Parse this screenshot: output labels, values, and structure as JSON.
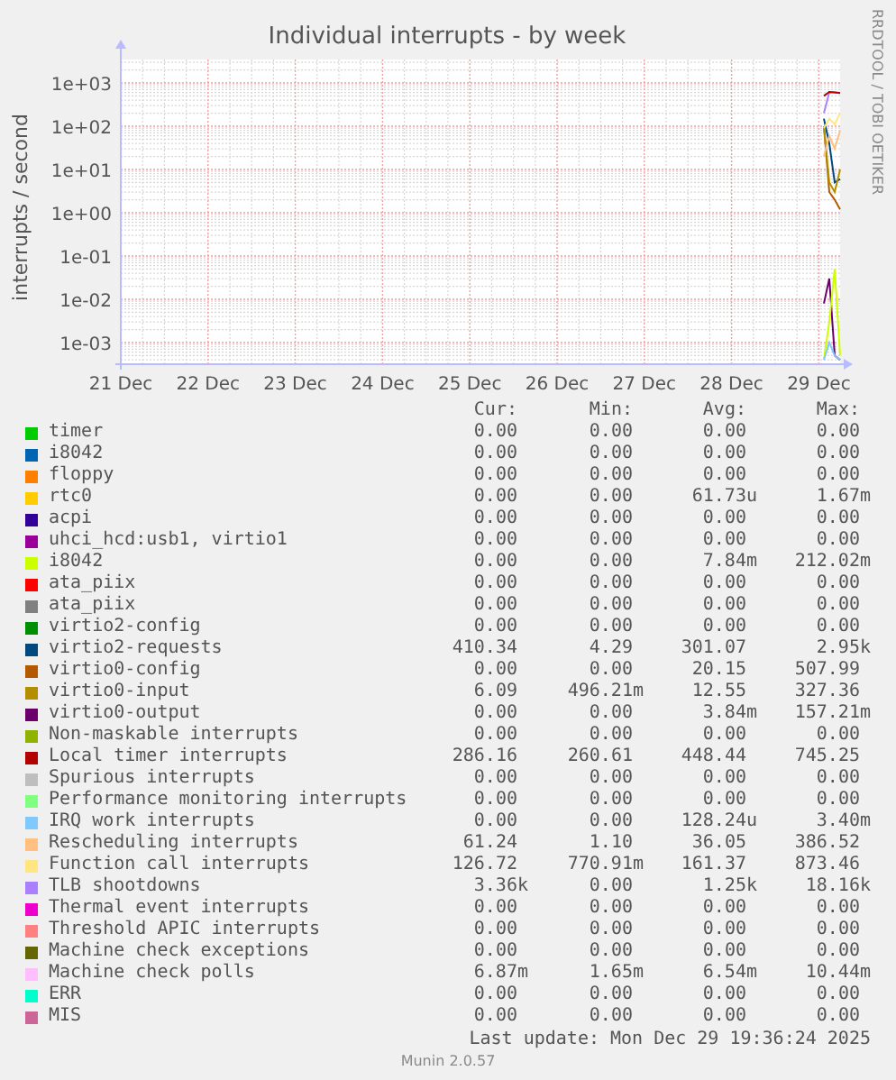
{
  "graph": {
    "title": "Individual interrupts - by week",
    "credit": "RRDTOOL / TOBI OETIKER",
    "y_axis_title": "interrupts / second",
    "y_axis_labels": [
      "1e+03",
      "1e+02",
      "1e+01",
      "1e+00",
      "1e-01",
      "1e-02",
      "1e-03"
    ],
    "x_axis_labels": [
      "21 Dec",
      "22 Dec",
      "23 Dec",
      "24 Dec",
      "25 Dec",
      "26 Dec",
      "27 Dec",
      "28 Dec",
      "29 Dec"
    ]
  },
  "legend": {
    "columns": [
      "Cur:",
      "Min:",
      "Avg:",
      "Max:"
    ],
    "rows": [
      {
        "name": "timer",
        "color": "#00cc00",
        "cur": "0.00",
        "min": "0.00",
        "avg": "0.00",
        "max": "0.00"
      },
      {
        "name": "i8042",
        "color": "#0066b3",
        "cur": "0.00",
        "min": "0.00",
        "avg": "0.00",
        "max": "0.00"
      },
      {
        "name": "floppy",
        "color": "#ff8000",
        "cur": "0.00",
        "min": "0.00",
        "avg": "0.00",
        "max": "0.00"
      },
      {
        "name": "rtc0",
        "color": "#ffcc00",
        "cur": "0.00",
        "min": "0.00",
        "avg": "61.73u",
        "max": "1.67m"
      },
      {
        "name": "acpi",
        "color": "#330099",
        "cur": "0.00",
        "min": "0.00",
        "avg": "0.00",
        "max": "0.00"
      },
      {
        "name": "uhci_hcd:usb1, virtio1",
        "color": "#990099",
        "cur": "0.00",
        "min": "0.00",
        "avg": "0.00",
        "max": "0.00"
      },
      {
        "name": "i8042",
        "color": "#ccff00",
        "cur": "0.00",
        "min": "0.00",
        "avg": "7.84m",
        "max": "212.02m"
      },
      {
        "name": "ata_piix",
        "color": "#ff0000",
        "cur": "0.00",
        "min": "0.00",
        "avg": "0.00",
        "max": "0.00"
      },
      {
        "name": "ata_piix",
        "color": "#808080",
        "cur": "0.00",
        "min": "0.00",
        "avg": "0.00",
        "max": "0.00"
      },
      {
        "name": "virtio2-config",
        "color": "#008f00",
        "cur": "0.00",
        "min": "0.00",
        "avg": "0.00",
        "max": "0.00"
      },
      {
        "name": "virtio2-requests",
        "color": "#00487d",
        "cur": "410.34",
        "min": "4.29",
        "avg": "301.07",
        "max": "2.95k"
      },
      {
        "name": "virtio0-config",
        "color": "#b35a00",
        "cur": "0.00",
        "min": "0.00",
        "avg": "20.15",
        "max": "507.99"
      },
      {
        "name": "virtio0-input",
        "color": "#b38f00",
        "cur": "6.09",
        "min": "496.21m",
        "avg": "12.55",
        "max": "327.36"
      },
      {
        "name": "virtio0-output",
        "color": "#6b006b",
        "cur": "0.00",
        "min": "0.00",
        "avg": "3.84m",
        "max": "157.21m"
      },
      {
        "name": "Non-maskable interrupts",
        "color": "#8fb300",
        "cur": "0.00",
        "min": "0.00",
        "avg": "0.00",
        "max": "0.00"
      },
      {
        "name": "Local timer interrupts",
        "color": "#b30000",
        "cur": "286.16",
        "min": "260.61",
        "avg": "448.44",
        "max": "745.25"
      },
      {
        "name": "Spurious interrupts",
        "color": "#bebebe",
        "cur": "0.00",
        "min": "0.00",
        "avg": "0.00",
        "max": "0.00"
      },
      {
        "name": "Performance monitoring interrupts",
        "color": "#80ff80",
        "cur": "0.00",
        "min": "0.00",
        "avg": "0.00",
        "max": "0.00"
      },
      {
        "name": "IRQ work interrupts",
        "color": "#80c9ff",
        "cur": "0.00",
        "min": "0.00",
        "avg": "128.24u",
        "max": "3.40m"
      },
      {
        "name": "Rescheduling interrupts",
        "color": "#ffc080",
        "cur": "61.24",
        "min": "1.10",
        "avg": "36.05",
        "max": "386.52"
      },
      {
        "name": "Function call interrupts",
        "color": "#ffe680",
        "cur": "126.72",
        "min": "770.91m",
        "avg": "161.37",
        "max": "873.46"
      },
      {
        "name": "TLB shootdowns",
        "color": "#aa80ff",
        "cur": "3.36k",
        "min": "0.00",
        "avg": "1.25k",
        "max": "18.16k"
      },
      {
        "name": "Thermal event interrupts",
        "color": "#ee00cc",
        "cur": "0.00",
        "min": "0.00",
        "avg": "0.00",
        "max": "0.00"
      },
      {
        "name": "Threshold APIC interrupts",
        "color": "#ff8080",
        "cur": "0.00",
        "min": "0.00",
        "avg": "0.00",
        "max": "0.00"
      },
      {
        "name": "Machine check exceptions",
        "color": "#666600",
        "cur": "0.00",
        "min": "0.00",
        "avg": "0.00",
        "max": "0.00"
      },
      {
        "name": "Machine check polls",
        "color": "#ffbfff",
        "cur": "6.87m",
        "min": "1.65m",
        "avg": "6.54m",
        "max": "10.44m"
      },
      {
        "name": "ERR",
        "color": "#00ffcc",
        "cur": "0.00",
        "min": "0.00",
        "avg": "0.00",
        "max": "0.00"
      },
      {
        "name": "MIS",
        "color": "#cc6699",
        "cur": "0.00",
        "min": "0.00",
        "avg": "0.00",
        "max": "0.00"
      }
    ]
  },
  "last_update": "Last update: Mon Dec 29 19:36:24 2025",
  "version": "Munin 2.0.57"
}
